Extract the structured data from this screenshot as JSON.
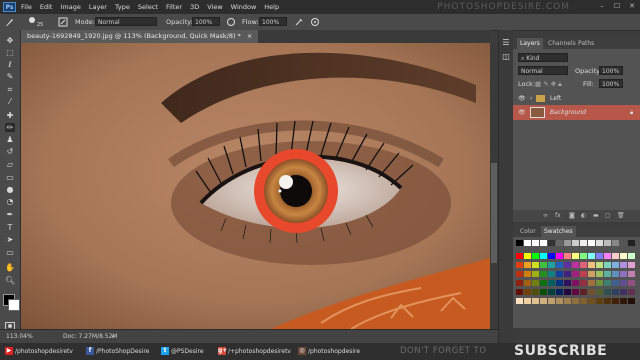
{
  "menubar": {
    "logo": "Ps",
    "items": [
      "File",
      "Edit",
      "Image",
      "Layer",
      "Type",
      "Select",
      "Filter",
      "3D",
      "View",
      "Window",
      "Help"
    ],
    "watermark": "PHOTOSHOPDESIRE.COM",
    "minimize": "–",
    "restore": "☐",
    "close": "✕"
  },
  "options": {
    "brush_size": "25",
    "mode_label": "Mode:",
    "mode_value": "Normal",
    "opacity_label": "Opacity:",
    "opacity_value": "100%",
    "flow_label": "Flow:",
    "flow_value": "100%"
  },
  "document": {
    "tab_title": "beauty-1692849_1920.jpg @ 113% (Background, Quick Mask/8) *",
    "tab_close": "×"
  },
  "status": {
    "zoom": "113.04%",
    "doc_size": "Doc: 7.27M/8.52M"
  },
  "layers_panel": {
    "tabs": [
      "Layers",
      "Channels",
      "Paths"
    ],
    "filter_label": "Kind",
    "blend_mode": "Normal",
    "opacity_label": "Opacity:",
    "opacity_value": "100%",
    "lock_label": "Lock:",
    "fill_label": "Fill:",
    "fill_value": "100%",
    "layers": [
      {
        "name": "Left",
        "type": "group"
      },
      {
        "name": "Background",
        "type": "layer",
        "selected": true
      }
    ],
    "selected_color": "#b7574a"
  },
  "swatches_panel": {
    "tabs": [
      "Color",
      "Swatches"
    ]
  },
  "toolbox": {
    "tools": [
      "move-tool",
      "marquee-tool",
      "lasso-tool",
      "quick-select-tool",
      "crop-tool",
      "eyedropper-tool",
      "healing-brush-tool",
      "brush-tool",
      "clone-stamp-tool",
      "history-brush-tool",
      "eraser-tool",
      "gradient-tool",
      "blur-tool",
      "dodge-tool",
      "pen-tool",
      "type-tool",
      "path-select-tool",
      "shape-tool",
      "hand-tool",
      "zoom-tool"
    ],
    "active_tool": "brush-tool"
  },
  "social": {
    "items": [
      {
        "icon": "youtube-icon",
        "text": "/photoshopdesiretv"
      },
      {
        "icon": "facebook-icon",
        "text": "/PhotoShopDesire"
      },
      {
        "icon": "twitter-icon",
        "text": "@PSDesire"
      },
      {
        "icon": "googleplus-icon",
        "text": "/+photoshopdesiretv"
      },
      {
        "icon": "instagram-icon",
        "text": "/photoshopdesire"
      }
    ],
    "reminder": "DON'T FORGET TO",
    "subscribe": "SUBSCRIBE"
  },
  "colors": {
    "mask_overlay": "#e8482c",
    "iris": "#b86a2a",
    "skin": "#a67b5c"
  }
}
